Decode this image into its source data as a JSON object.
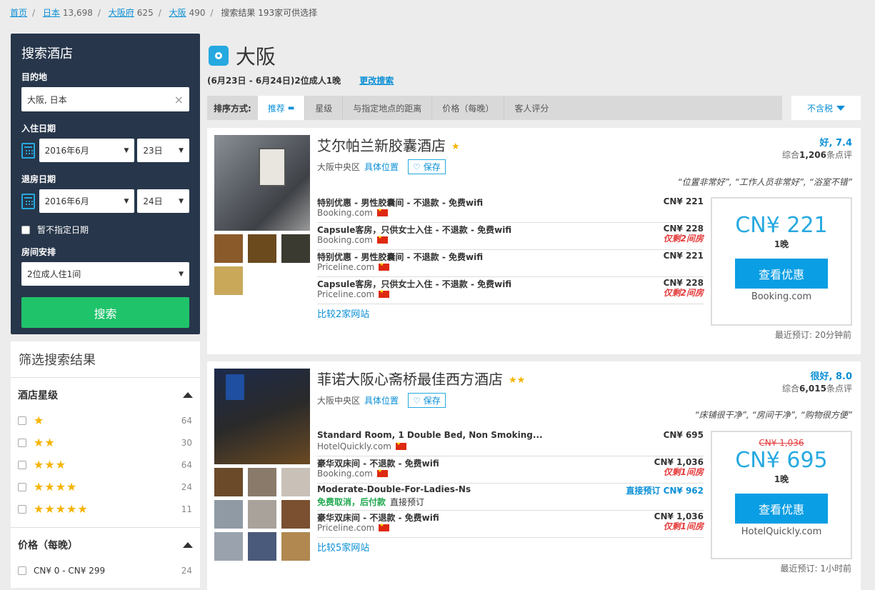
{
  "breadcrumb": [
    {
      "label": "首页",
      "count": ""
    },
    {
      "label": "日本",
      "count": "13,698"
    },
    {
      "label": "大阪府",
      "count": "625"
    },
    {
      "label": "大阪",
      "count": "490"
    }
  ],
  "breadcrumb_current": "搜索结果 193家可供选择",
  "search": {
    "title": "搜索酒店",
    "dest_label": "目的地",
    "dest_value": "大阪, 日本",
    "clear_icon": "×",
    "checkin_label": "入住日期",
    "checkin_month": "2016年6月",
    "checkin_day": "23日",
    "checkout_label": "退房日期",
    "checkout_month": "2016年6月",
    "checkout_day": "24日",
    "no_dates_label": "暂不指定日期",
    "rooms_label": "房间安排",
    "rooms_value": "2位成人住1间",
    "search_button": "搜索",
    "arrow": "▼"
  },
  "filter": {
    "title": "筛选搜索结果",
    "stars_heading": "酒店星级",
    "star_rows": [
      {
        "stars": "★",
        "count": "64"
      },
      {
        "stars": "★★",
        "count": "30"
      },
      {
        "stars": "★★★",
        "count": "64"
      },
      {
        "stars": "★★★★",
        "count": "24"
      },
      {
        "stars": "★★★★★",
        "count": "11"
      }
    ],
    "price_heading": "价格（每晚）",
    "price_rows": [
      {
        "label": "CN¥ 0 - CN¥ 299",
        "count": "24"
      }
    ]
  },
  "header": {
    "city": "大阪",
    "dates": "(6月23日 - 6月24日)2位成人1晚",
    "change_search": "更改搜索"
  },
  "sort": {
    "label": "排序方式:",
    "options": [
      "推荐",
      "星级",
      "与指定地点的距离",
      "价格（每晚）",
      "客人评分"
    ],
    "tax": "不含税"
  },
  "hotels": [
    {
      "name": "艾尔帕兰新胶囊酒店",
      "stars": "★",
      "district": "大阪中央区",
      "location_link": "具体位置",
      "save": "保存",
      "rating": "好, 7.4",
      "reviews_prefix": "综合",
      "reviews_count": "1,206",
      "reviews_suffix": "条点评",
      "quote": "“位置非常好”, “工作人员非常好”, “浴室不错”",
      "offers": [
        {
          "name": "特别优惠 - 男性胶囊间 - 不退款 - 免费wifi",
          "site": "Booking.com",
          "price": "CN¥ 221",
          "warn": ""
        },
        {
          "name": "Capsule客房，只供女士入住 - 不退款 - 免费wifi",
          "site": "Booking.com",
          "price": "CN¥ 228",
          "warn": "仅剩2间房"
        },
        {
          "name": "特别优惠 - 男性胶囊间 - 不退款 - 免费wifi",
          "site": "Priceline.com",
          "price": "CN¥ 221",
          "warn": ""
        },
        {
          "name": "Capsule客房，只供女士入住 - 不退款 - 免费wifi",
          "site": "Priceline.com",
          "price": "CN¥ 228",
          "warn": "仅剩2间房"
        }
      ],
      "compare": "比较2家网站",
      "deal_price": "CN¥ 221",
      "deal_nights": "1晚",
      "deal_button": "查看优惠",
      "deal_site": "Booking.com",
      "recent": "最近预订: 20分钟前"
    },
    {
      "name": "菲诺大阪心斋桥最佳西方酒店",
      "stars": "★★",
      "district": "大阪中央区",
      "location_link": "具体位置",
      "save": "保存",
      "rating": "很好, 8.0",
      "reviews_prefix": "综合",
      "reviews_count": "6,015",
      "reviews_suffix": "条点评",
      "quote": "“床铺很干净”, “房间干净”, “购物很方便”",
      "offers": [
        {
          "name": "Standard Room, 1 Double Bed, Non Smoking...",
          "site": "HotelQuickly.com",
          "price": "CN¥ 695",
          "warn": ""
        },
        {
          "name": "豪华双床间 - 不退款 - 免费wifi",
          "site": "Booking.com",
          "price": "CN¥ 1,036",
          "warn": "仅剩1间房"
        },
        {
          "name": "Moderate-Double-For-Ladies-Ns",
          "site_green": "免费取消，后付款",
          "site": "直接预订",
          "price_label": "直接预订",
          "price": "CN¥ 962",
          "warn": ""
        },
        {
          "name": "豪华双床间 - 不退款 - 免费wifi",
          "site": "Priceline.com",
          "price": "CN¥ 1,036",
          "warn": "仅剩1间房"
        }
      ],
      "compare": "比较5家网站",
      "deal_old": "CN¥ 1,036",
      "deal_price": "CN¥ 695",
      "deal_nights": "1晚",
      "deal_button": "查看优惠",
      "deal_site": "HotelQuickly.com",
      "recent": "最近预订: 1小时前"
    }
  ],
  "colors": {
    "accent": "#0a8fd6",
    "search_bg": "#27364a",
    "search_btn": "#1fc36a",
    "star": "#f5b400",
    "warn": "#e43d3d"
  }
}
